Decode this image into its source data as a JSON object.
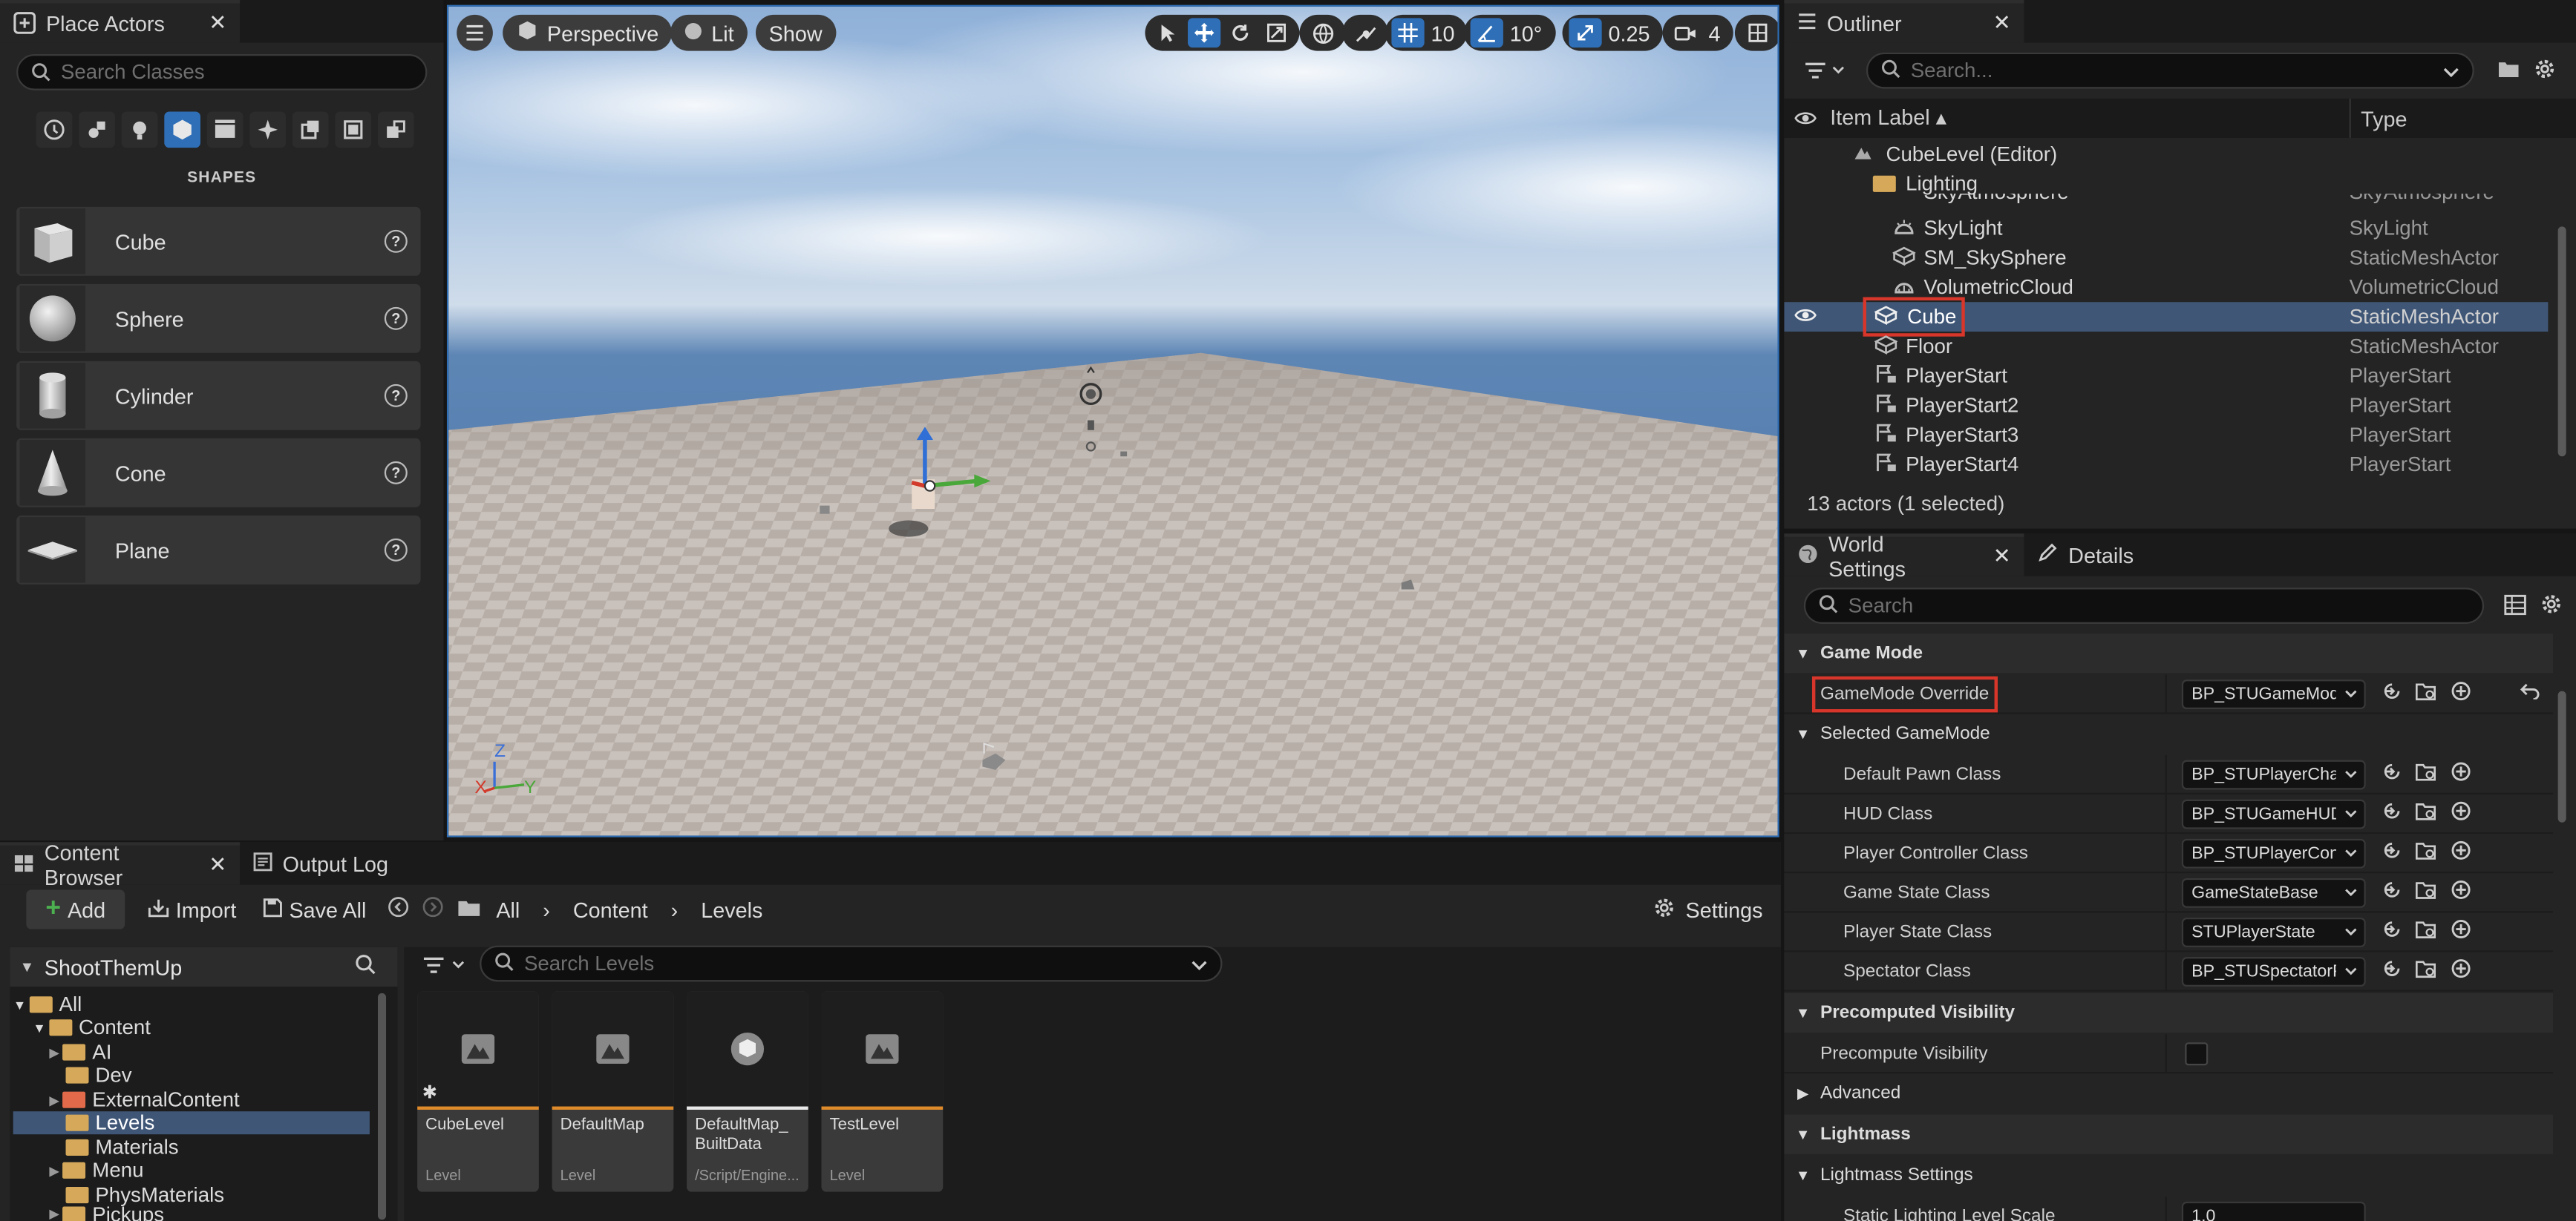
{
  "place_actors": {
    "tab_label": "Place Actors",
    "search_placeholder": "Search Classes",
    "section_title": "SHAPES",
    "items": [
      {
        "label": "Cube",
        "icon": "cube-icon"
      },
      {
        "label": "Sphere",
        "icon": "sphere-icon"
      },
      {
        "label": "Cylinder",
        "icon": "cylinder-icon"
      },
      {
        "label": "Cone",
        "icon": "cone-icon"
      },
      {
        "label": "Plane",
        "icon": "plane-icon"
      }
    ]
  },
  "viewport": {
    "perspective_label": "Perspective",
    "lit_label": "Lit",
    "show_label": "Show",
    "grid_snap": "10",
    "rotation_snap": "10°",
    "scale_snap": "0.25",
    "camera_speed": "4",
    "axis_labels": {
      "x": "X",
      "y": "Y",
      "z": "Z"
    }
  },
  "outliner": {
    "tab_label": "Outliner",
    "search_placeholder": "Search...",
    "col_label": "Item Label",
    "col_type": "Type",
    "rows": [
      {
        "label": "CubeLevel (Editor)",
        "type": ""
      },
      {
        "label": "Lighting",
        "type": ""
      },
      {
        "label": "SkyAtmosphere",
        "type": "SkyAtmosphere"
      },
      {
        "label": "SkyLight",
        "type": "SkyLight"
      },
      {
        "label": "SM_SkySphere",
        "type": "StaticMeshActor"
      },
      {
        "label": "VolumetricCloud",
        "type": "VolumetricCloud"
      },
      {
        "label": "Cube",
        "type": "StaticMeshActor"
      },
      {
        "label": "Floor",
        "type": "StaticMeshActor"
      },
      {
        "label": "PlayerStart",
        "type": "PlayerStart"
      },
      {
        "label": "PlayerStart2",
        "type": "PlayerStart"
      },
      {
        "label": "PlayerStart3",
        "type": "PlayerStart"
      },
      {
        "label": "PlayerStart4",
        "type": "PlayerStart"
      }
    ],
    "status": "13 actors (1 selected)"
  },
  "details": {
    "tab_world": "World Settings",
    "tab_details": "Details",
    "search_placeholder": "Search",
    "sections": {
      "game_mode": "Game Mode",
      "selected_game_mode": "Selected GameMode",
      "precomputed_visibility": "Precomputed Visibility",
      "advanced": "Advanced",
      "lightmass": "Lightmass",
      "lightmass_settings": "Lightmass Settings"
    },
    "props": {
      "gamemode_override": {
        "name": "GameMode Override",
        "value": "BP_STUGameMode"
      },
      "default_pawn": {
        "name": "Default Pawn Class",
        "value": "BP_STUPlayerCharacter"
      },
      "hud": {
        "name": "HUD Class",
        "value": "BP_STUGameHUD"
      },
      "player_controller": {
        "name": "Player Controller Class",
        "value": "BP_STUPlayerController"
      },
      "game_state": {
        "name": "Game State Class",
        "value": "GameStateBase"
      },
      "player_state": {
        "name": "Player State Class",
        "value": "STUPlayerState"
      },
      "spectator": {
        "name": "Spectator Class",
        "value": "BP_STUSpectatorPawn"
      },
      "precompute_visibility": {
        "name": "Precompute Visibility"
      },
      "static_lighting_scale": {
        "name": "Static Lighting Level Scale",
        "value": "1.0"
      }
    }
  },
  "content_browser": {
    "tab_label": "Content Browser",
    "output_log_label": "Output Log",
    "add_label": "Add",
    "import_label": "Import",
    "save_all_label": "Save All",
    "breadcrumb": [
      "All",
      "Content",
      "Levels"
    ],
    "settings_label": "Settings",
    "project_name": "ShootThemUp",
    "search_placeholder": "Search Levels",
    "tree": [
      {
        "label": "All"
      },
      {
        "label": "Content"
      },
      {
        "label": "AI"
      },
      {
        "label": "Dev"
      },
      {
        "label": "ExternalContent"
      },
      {
        "label": "Levels"
      },
      {
        "label": "Materials"
      },
      {
        "label": "Menu"
      },
      {
        "label": "PhysMaterials"
      },
      {
        "label": "Pickups"
      }
    ],
    "assets": [
      {
        "name": "CubeLevel",
        "type": "Level"
      },
      {
        "name": "DefaultMap",
        "type": "Level"
      },
      {
        "name": "DefaultMap_ BuiltData",
        "type": "/Script/Engine..."
      },
      {
        "name": "TestLevel",
        "type": "Level"
      }
    ]
  },
  "colors": {
    "accent": "#2f6fb7",
    "selection": "#3f5677",
    "highlight_box": "#d8362a",
    "level_bar": "#e08b2b"
  }
}
